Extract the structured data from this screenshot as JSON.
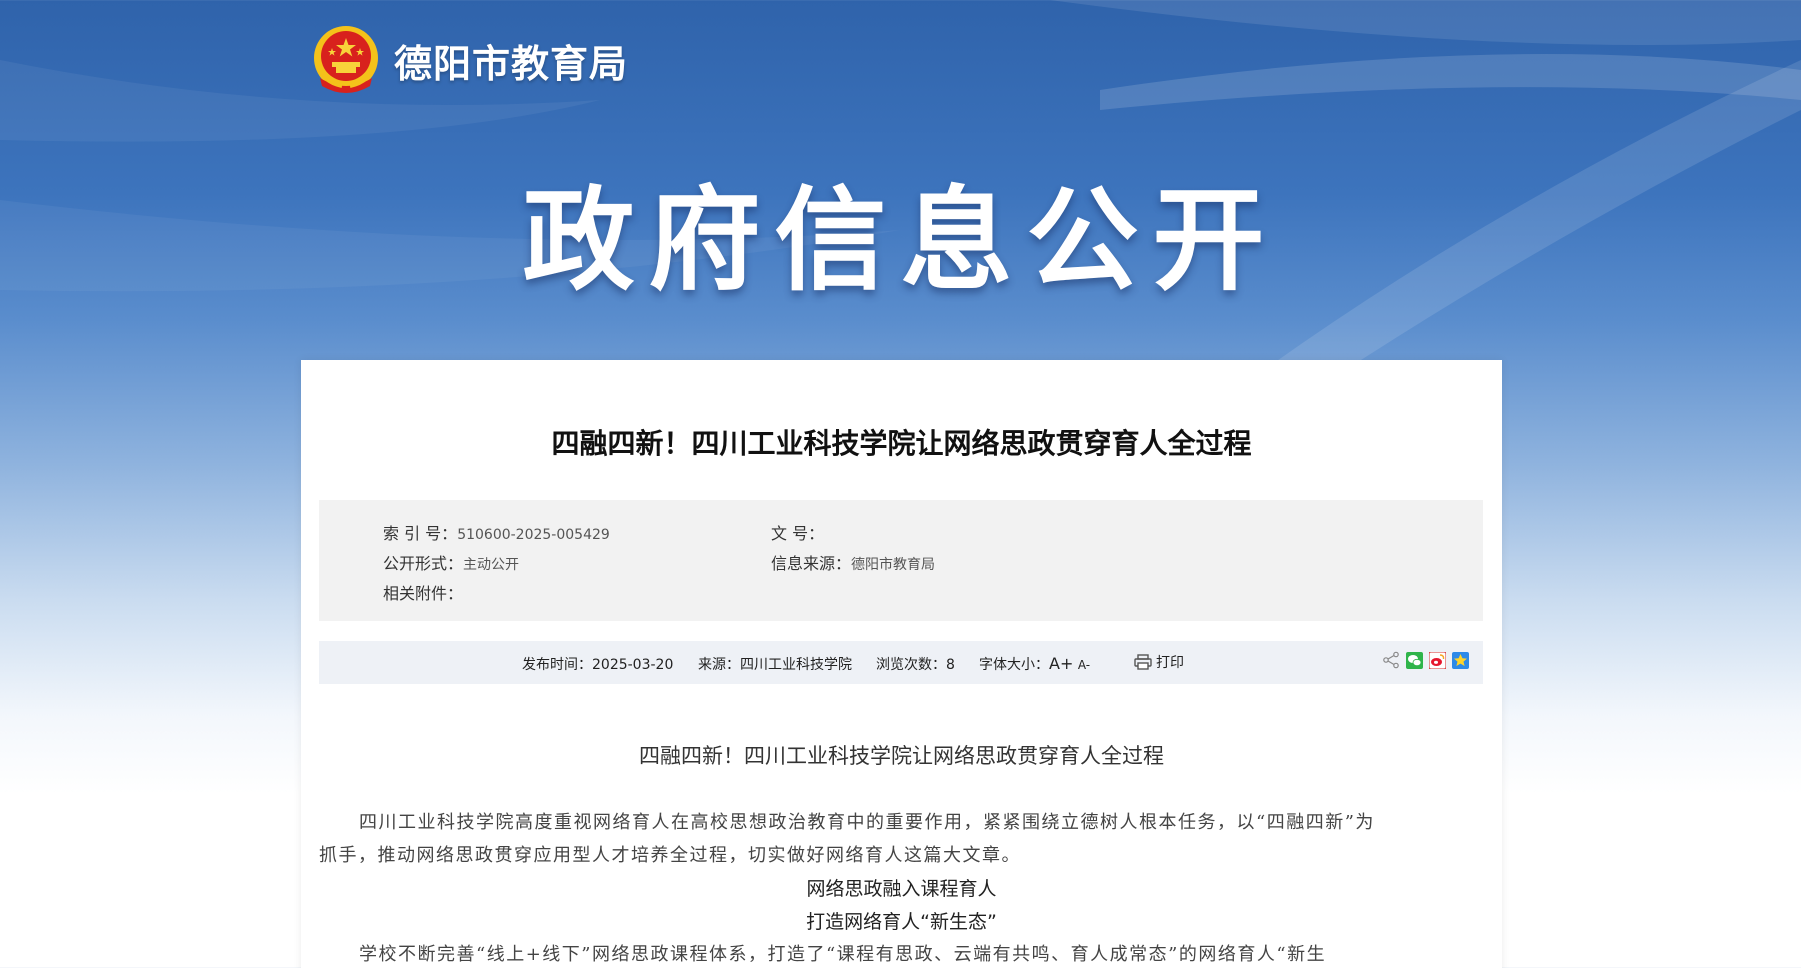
{
  "site": {
    "name": "德阳市教育局",
    "hero_title": "政府信息公开"
  },
  "article": {
    "title": "四融四新！四川工业科技学院让网络思政贯穿育人全过程",
    "meta": {
      "index_label": "索 引 号：",
      "index_value": "510600-2025-005429",
      "doc_no_label": "文 号：",
      "doc_no_value": "",
      "open_form_label": "公开形式：",
      "open_form_value": "主动公开",
      "source_label": "信息来源：",
      "source_value": "德阳市教育局",
      "attachment_label": "相关附件：",
      "attachment_value": ""
    },
    "info_bar": {
      "publish_label": "发布时间：",
      "publish_date": "2025-03-20",
      "from_label": "来源：",
      "from_value": "四川工业科技学院",
      "views_label": "浏览次数：",
      "views_value": "8",
      "font_size_label": "字体大小：",
      "font_up": "A+",
      "font_down": "A-",
      "print_label": "打印"
    },
    "body": {
      "heading": "四融四新！四川工业科技学院让网络思政贯穿育人全过程",
      "intro_line1": "四川工业科技学院高度重视网络育人在高校思想政治教育中的重要作用，紧紧围绕立德树人根本任务，以“四融四新”为",
      "intro_line2": "抓手，推动网络思政贯穿应用型人才培养全过程，切实做好网络育人这篇大文章。",
      "subhead1": "网络思政融入课程育人",
      "subhead2": "打造网络育人“新生态”",
      "para2_line1": "学校不断完善“线上+线下”网络思政课程体系，打造了“课程有思政、云端有共鸣、育人成常态”的网络育人“新生"
    }
  },
  "colors": {
    "banner_top": "#2f63ab",
    "banner_mid": "#8fb3de",
    "card_bg": "#ffffff",
    "meta_bg": "#f2f2f2",
    "info_bg": "#eef1f6"
  },
  "icons": [
    "national-emblem-icon",
    "share-icon",
    "wechat-icon",
    "weibo-icon",
    "qzone-icon",
    "printer-icon"
  ]
}
